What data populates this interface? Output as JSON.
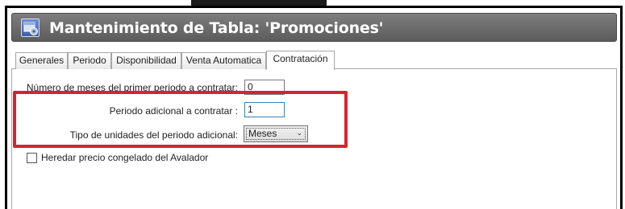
{
  "window": {
    "title": "Mantenimiento de Tabla: 'Promociones'"
  },
  "tabs": [
    {
      "label": "Generales",
      "active": false
    },
    {
      "label": "Periodo",
      "active": false
    },
    {
      "label": "Disponibilidad",
      "active": false
    },
    {
      "label": "Venta Automatica",
      "active": false
    },
    {
      "label": "Contratación",
      "active": true
    }
  ],
  "form": {
    "first_period_label": "Número de meses del primer periodo a contratar:",
    "first_period_value": "0",
    "additional_period_label": "Periodo adicional a contratar :",
    "additional_period_value": "1",
    "unit_type_label": "Tipo de unidades del periodo adicional:",
    "unit_type_value": "Meses",
    "inherit_label": "Heredar precio congelado del Avalador",
    "inherit_checked": false
  },
  "colors": {
    "highlight": "#d6242e",
    "titlebar": "#6b6b6b"
  }
}
